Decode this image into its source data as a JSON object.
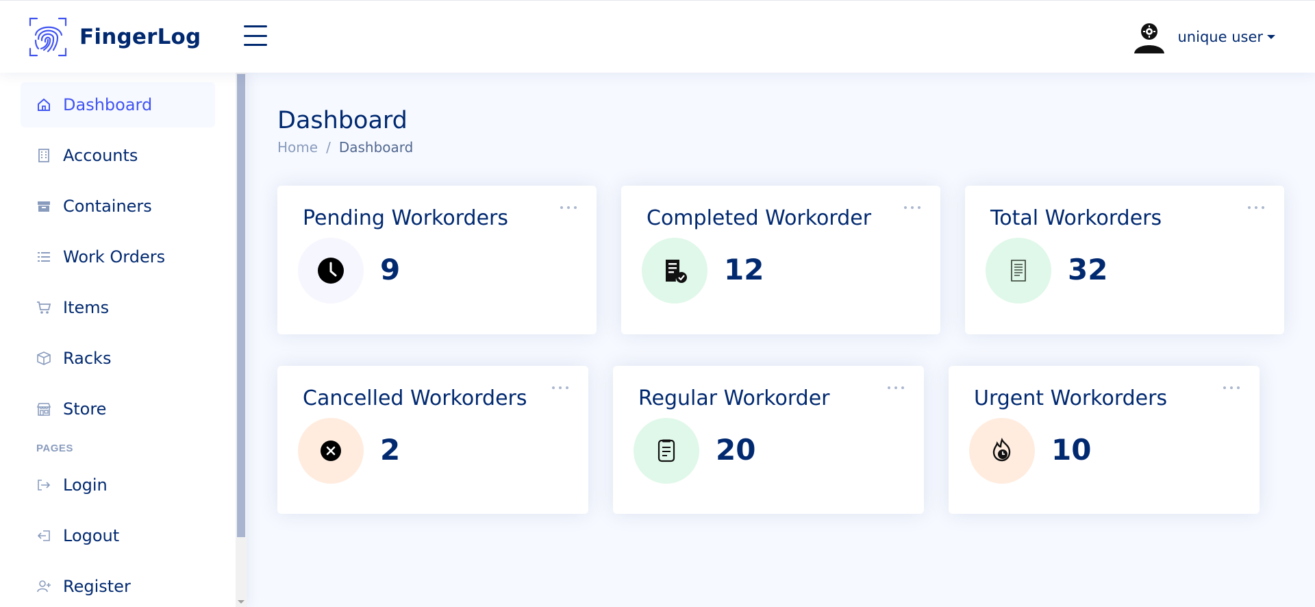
{
  "header": {
    "brand": "FingerLog",
    "user_name": "unique user"
  },
  "sidebar": {
    "items": [
      {
        "label": "Dashboard",
        "icon": "house-icon"
      },
      {
        "label": "Accounts",
        "icon": "building-icon"
      },
      {
        "label": "Containers",
        "icon": "archive-icon"
      },
      {
        "label": "Work Orders",
        "icon": "list-icon"
      },
      {
        "label": "Items",
        "icon": "cart-icon"
      },
      {
        "label": "Racks",
        "icon": "box-icon"
      },
      {
        "label": "Store",
        "icon": "shop-icon"
      }
    ],
    "pages_heading": "PAGES",
    "pages": [
      {
        "label": "Login",
        "icon": "login-icon"
      },
      {
        "label": "Logout",
        "icon": "logout-icon"
      },
      {
        "label": "Register",
        "icon": "person-plus-icon"
      }
    ]
  },
  "main": {
    "title": "Dashboard",
    "breadcrumb": {
      "home": "Home",
      "separator": "/",
      "current": "Dashboard"
    },
    "cards": [
      {
        "title": "Pending Workorders",
        "value": "9",
        "icon": "clock-icon",
        "icon_bg": "#f6f6fe"
      },
      {
        "title": "Completed Workorder",
        "value": "12",
        "icon": "receipt-check-icon",
        "icon_bg": "#e0f8e9"
      },
      {
        "title": "Total Workorders",
        "value": "32",
        "icon": "receipt-icon",
        "icon_bg": "#e0f8e9"
      },
      {
        "title": "Cancelled Workorders",
        "value": "2",
        "icon": "x-circle-icon",
        "icon_bg": "#ffecdf"
      },
      {
        "title": "Regular Workorder",
        "value": "20",
        "icon": "document-icon",
        "icon_bg": "#e0f8e9"
      },
      {
        "title": "Urgent Workorders",
        "value": "10",
        "icon": "fire-clock-icon",
        "icon_bg": "#ffecdf"
      }
    ]
  },
  "colors": {
    "primary": "#4154f1",
    "text": "#012970",
    "muted": "#899bbd",
    "background": "#f6f9ff"
  }
}
